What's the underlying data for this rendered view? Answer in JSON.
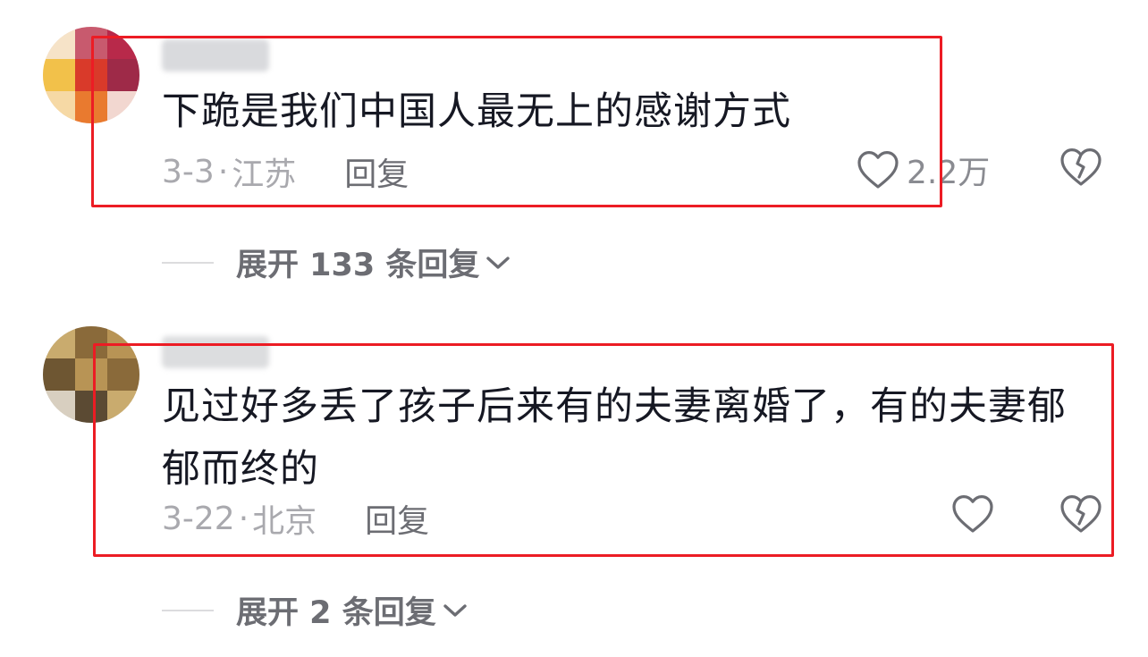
{
  "comments": [
    {
      "text_lines": [
        "下跪是我们中国人最无上的感谢方式"
      ],
      "date": "3-3",
      "separator": "·",
      "location": "江苏",
      "reply_label": "回复",
      "like_count": "2.2万",
      "expand_label": "展开 133 条回复",
      "avatar_colors": [
        "#f2c14a",
        "#e97a2f",
        "#d93a2a",
        "#b8294a",
        "#f6e3c8",
        "#c85a6e"
      ],
      "username_color": "#d9dadd"
    },
    {
      "text_lines": [
        "见过好多丢了孩子后来有的夫妻离婚了，有的夫妻郁",
        "郁而终的"
      ],
      "date": "3-22",
      "separator": "·",
      "location": "北京",
      "reply_label": "回复",
      "like_count": "",
      "expand_label": "展开 2 条回复",
      "avatar_colors": [
        "#8a6a3a",
        "#b89455",
        "#6e5632",
        "#c9ab6e",
        "#d8cfc0",
        "#5b4a33"
      ],
      "username_color": "#dcdddf"
    }
  ],
  "icons": {
    "like": "heart-outline-icon",
    "dislike": "broken-heart-icon",
    "expand": "chevron-down-icon"
  },
  "colors": {
    "highlight": "#ec1c24",
    "meta_text": "#a9a9ae",
    "reply_text": "#6c6d73"
  }
}
